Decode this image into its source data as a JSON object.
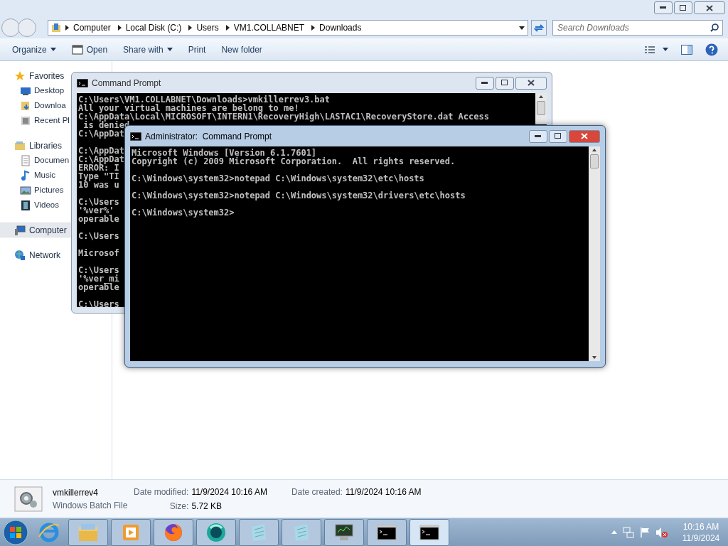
{
  "explorer": {
    "breadcrumb": [
      "Computer",
      "Local Disk (C:)",
      "Users",
      "VM1.COLLABNET",
      "Downloads"
    ],
    "search": {
      "placeholder": "Search Downloads"
    },
    "toolbar": [
      {
        "label": "Organize",
        "kind": "menu"
      },
      {
        "label": "Open",
        "kind": "open"
      },
      {
        "label": "Share with",
        "kind": "menu"
      },
      {
        "label": "Print",
        "kind": "plain"
      },
      {
        "label": "New folder",
        "kind": "plain"
      }
    ],
    "nav": [
      {
        "label": "Favorites",
        "selected": false,
        "children": [
          {
            "label": "Desktop",
            "selected": false
          },
          {
            "label": "Downloa",
            "selected": false
          },
          {
            "label": "Recent Pl",
            "selected": false
          }
        ]
      },
      {
        "label": "Libraries",
        "selected": false,
        "children": [
          {
            "label": "Documen",
            "selected": false
          },
          {
            "label": "Music",
            "selected": false
          },
          {
            "label": "Pictures",
            "selected": false
          },
          {
            "label": "Videos",
            "selected": false
          }
        ]
      },
      {
        "label": "Computer",
        "selected": true
      },
      {
        "label": "Network",
        "selected": false
      }
    ],
    "details": {
      "name": "vmkillerrev4",
      "type": "Windows Batch File",
      "fields": [
        {
          "label": "Date modified:",
          "value": "11/9/2024 10:16 AM"
        },
        {
          "label": "Size:",
          "value": "5.72 KB"
        },
        {
          "label": "Date created:",
          "value": "11/9/2024 10:16 AM"
        }
      ]
    }
  },
  "consoles": [
    {
      "title": "Command Prompt",
      "active": false,
      "blocks": [
        [
          "C:\\Users\\VM1.COLLABNET\\Downloads>vmkillerrev3.bat",
          "All your virtual machines are belong to me!",
          "C:\\AppData\\Local\\MICROSOFT\\INTERN1\\RecoveryHigh\\LASTAC1\\RecoveryStore.dat Access",
          " is denied",
          "C:\\AppDat"
        ],
        [
          "C:\\AppDat",
          "C:\\AppDat",
          "ERROR: I",
          "Type \"TI",
          "10 was u"
        ],
        [
          "C:\\Users",
          "'%ver%'",
          "operable"
        ],
        [
          "C:\\Users"
        ],
        [
          "Microsof"
        ],
        [
          "C:\\Users",
          "'%ver_mi",
          "operable"
        ],
        [
          "C:\\Users"
        ]
      ]
    },
    {
      "title": "Administrator:  Command Prompt",
      "active": true,
      "blocks": [
        [
          "Microsoft Windows [Version 6.1.7601]",
          "Copyright (c) 2009 Microsoft Corporation.  All rights reserved."
        ],
        [
          "C:\\Windows\\system32>notepad C:\\Windows\\system32\\etc\\hosts"
        ],
        [
          "C:\\Windows\\system32>notepad C:\\Windows\\system32\\drivers\\etc\\hosts"
        ],
        [
          "C:\\Windows\\system32>"
        ]
      ]
    }
  ],
  "taskbar": {
    "items": [
      {
        "selected": false
      },
      {
        "selected": false
      },
      {
        "selected": false
      },
      {
        "selected": false
      },
      {
        "selected": false
      },
      {
        "selected": false
      },
      {
        "selected": false
      },
      {
        "selected": false
      },
      {
        "selected": false
      },
      {
        "selected": true
      }
    ],
    "clock": {
      "time": "10:16 AM",
      "date": "11/9/2024"
    }
  }
}
